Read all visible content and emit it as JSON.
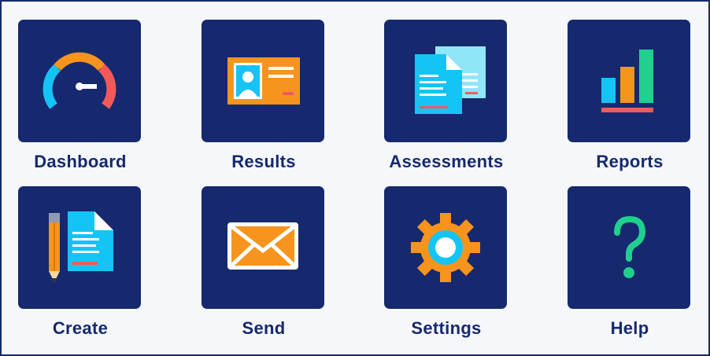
{
  "menu": {
    "dashboard": "Dashboard",
    "results": "Results",
    "assessments": "Assessments",
    "reports": "Reports",
    "create": "Create",
    "send": "Send",
    "settings": "Settings",
    "help": "Help"
  },
  "icons": {
    "dashboard": "speedometer-icon",
    "results": "id-card-icon",
    "assessments": "documents-icon",
    "reports": "bar-chart-icon",
    "create": "pencil-document-icon",
    "send": "envelope-icon",
    "settings": "gear-icon",
    "help": "question-mark-icon"
  },
  "colors": {
    "navy": "#16296e",
    "background": "#f5f7fb",
    "orange": "#f7941d",
    "cyan": "#14c4f5",
    "red": "#f25a5a",
    "green": "#1fd08f",
    "white": "#ffffff"
  }
}
